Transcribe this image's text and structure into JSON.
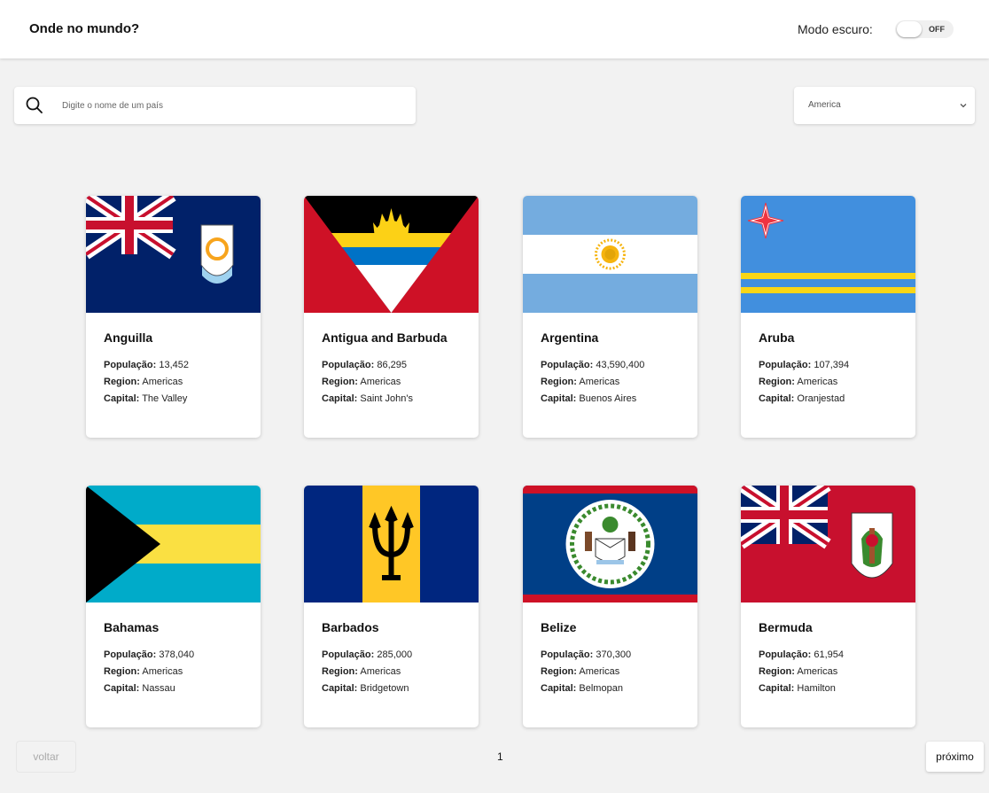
{
  "header": {
    "title": "Onde no mundo?",
    "dark_mode_label": "Modo escuro:",
    "toggle_state": "OFF"
  },
  "search": {
    "placeholder": "Digite o nome de um país",
    "value": ""
  },
  "region_filter": {
    "selected": "America"
  },
  "labels": {
    "population": "População:",
    "region": "Region:",
    "capital": "Capital:"
  },
  "countries": [
    {
      "name": "Anguilla",
      "population": "13,452",
      "region": "Americas",
      "capital": "The Valley"
    },
    {
      "name": "Antigua and Barbuda",
      "population": "86,295",
      "region": "Americas",
      "capital": "Saint John's"
    },
    {
      "name": "Argentina",
      "population": "43,590,400",
      "region": "Americas",
      "capital": "Buenos Aires"
    },
    {
      "name": "Aruba",
      "population": "107,394",
      "region": "Americas",
      "capital": "Oranjestad"
    },
    {
      "name": "Bahamas",
      "population": "378,040",
      "region": "Americas",
      "capital": "Nassau"
    },
    {
      "name": "Barbados",
      "population": "285,000",
      "region": "Americas",
      "capital": "Bridgetown"
    },
    {
      "name": "Belize",
      "population": "370,300",
      "region": "Americas",
      "capital": "Belmopan"
    },
    {
      "name": "Bermuda",
      "population": "61,954",
      "region": "Americas",
      "capital": "Hamilton"
    }
  ],
  "pagination": {
    "back_label": "voltar",
    "next_label": "próximo",
    "current_page": "1"
  },
  "colors": {
    "background": "#f2f2f2",
    "card": "#ffffff",
    "text": "#111111"
  }
}
